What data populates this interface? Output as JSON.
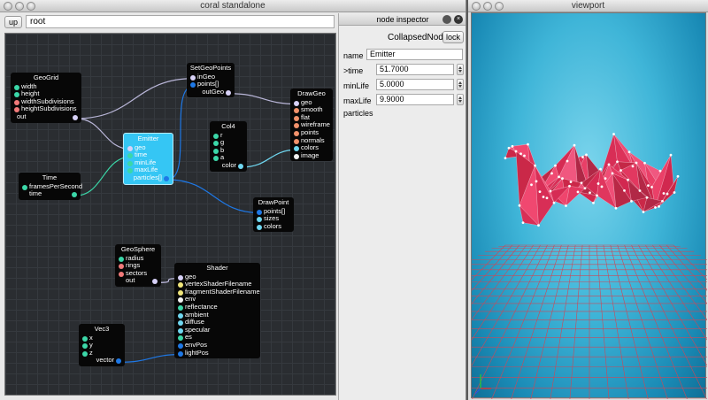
{
  "coral_window": {
    "title": "coral standalone",
    "up_label": "up",
    "path": "root"
  },
  "viewport_window": {
    "title": "viewport"
  },
  "inspector": {
    "title": "node inspector",
    "node_class": "CollapsedNode",
    "lock_label": "lock",
    "name_label": "name",
    "name_value": "Emitter",
    "fields": [
      {
        "label": ">time",
        "value": "51.7000"
      },
      {
        "label": "minLife",
        "value": "5.0000"
      },
      {
        "label": "maxLife",
        "value": "9.9000"
      }
    ],
    "particles_label": "particles"
  },
  "nodes": {
    "geogrid": {
      "title": "GeoGrid",
      "attrs": [
        "width",
        "height",
        "widthSubdivisions",
        "heightSubdivisions"
      ],
      "out": "out"
    },
    "setgeopoints": {
      "title": "SetGeoPoints",
      "attrs": [
        "inGeo",
        "points[]"
      ],
      "out": "outGeo"
    },
    "drawgeo": {
      "title": "DrawGeo",
      "attrs": [
        "geo",
        "smooth",
        "flat",
        "wireframe",
        "points",
        "normals",
        "colors",
        "image"
      ]
    },
    "col4": {
      "title": "Col4",
      "attrs": [
        "r",
        "g",
        "b",
        "a"
      ],
      "out": "color"
    },
    "emitter": {
      "title": "Emitter",
      "attrs": [
        "geo",
        "time",
        "minLife",
        "maxLife"
      ],
      "out": "particles[]"
    },
    "time": {
      "title": "Time",
      "attrs": [
        "framesPerSecond"
      ],
      "out": "time"
    },
    "drawpoint": {
      "title": "DrawPoint",
      "attrs": [
        "points[]",
        "sizes",
        "colors"
      ]
    },
    "geosphere": {
      "title": "GeoSphere",
      "attrs": [
        "radius",
        "rings",
        "sectors"
      ],
      "out": "out"
    },
    "shader": {
      "title": "Shader",
      "attrs": [
        "geo",
        "vertexShaderFilename",
        "fragmentShaderFilename",
        "env",
        "reflectance",
        "ambient",
        "diffuse",
        "specular",
        "es",
        "envPos",
        "lightPos"
      ]
    },
    "vec3": {
      "title": "Vec3",
      "attrs": [
        "x",
        "y",
        "z"
      ],
      "out": "vector"
    }
  },
  "colors": {
    "geo": "#d7d1f7",
    "float": "#3bd7a8",
    "int": "#f17a7a",
    "points": "#1e78e6",
    "color": "#6fd7f0",
    "string": "#f0e67a",
    "selected": "#35c6f4"
  }
}
